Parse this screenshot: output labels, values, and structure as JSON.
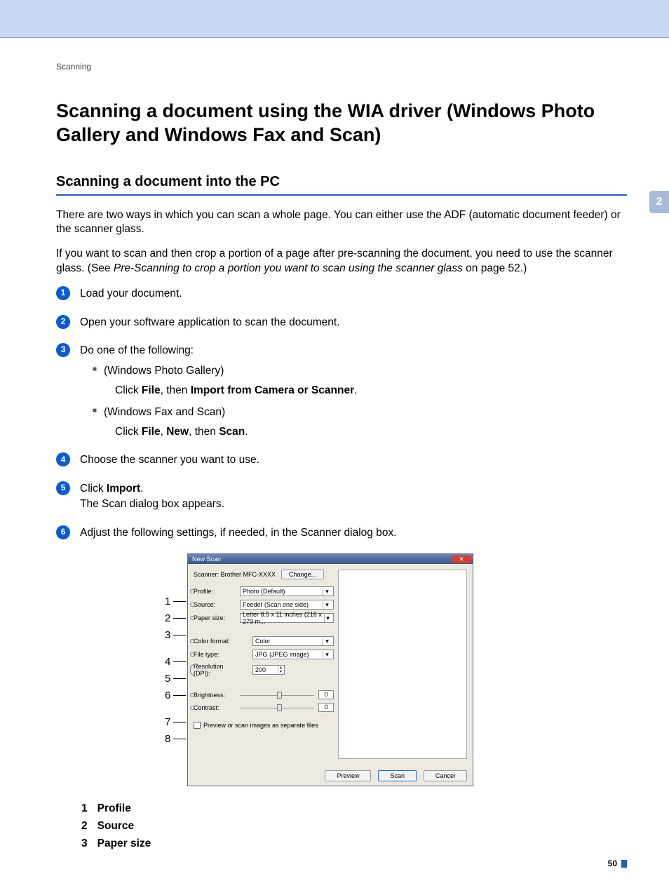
{
  "breadcrumb": "Scanning",
  "chapter_tab": "2",
  "title": "Scanning a document using the WIA driver (Windows Photo Gallery and Windows Fax and Scan)",
  "h2": "Scanning a document into the PC",
  "para1": "There are two ways in which you can scan a whole page. You can either use the ADF (automatic document feeder) or the scanner glass.",
  "para2_a": "If you want to scan and then crop a portion of a page after pre-scanning the document, you need to use the scanner glass. (See ",
  "para2_link": "Pre-Scanning to crop a portion you want to scan using the scanner glass",
  "para2_b": " on page 52.)",
  "steps": {
    "s1": "Load your document.",
    "s2": "Open your software application to scan the document.",
    "s3": "Do one of the following:",
    "s3a": "(Windows Photo Gallery)",
    "s3a_click_a": "Click ",
    "s3a_file": "File",
    "s3a_then": ", then ",
    "s3a_import": "Import from Camera or Scanner",
    "s3a_dot": ".",
    "s3b": "(Windows Fax and Scan)",
    "s3b_click_a": "Click ",
    "s3b_file": "File",
    "s3b_c1": ", ",
    "s3b_new": "New",
    "s3b_c2": ", then ",
    "s3b_scan": "Scan",
    "s3b_dot": ".",
    "s4": "Choose the scanner you want to use.",
    "s5a": "Click ",
    "s5b": "Import",
    "s5c": ".",
    "s5d": "The Scan dialog box appears.",
    "s6": "Adjust the following settings, if needed, in the Scanner dialog box."
  },
  "dialog": {
    "title": "New Scan",
    "close": "✕",
    "scanner_lbl": "Scanner: Brother MFC-XXXX",
    "change": "Change...",
    "fields": {
      "profile_l": "Profile:",
      "profile_v": "Photo (Default)",
      "source_l": "Source:",
      "source_v": "Feeder (Scan one side)",
      "paper_l": "Paper size:",
      "paper_v": "Letter 8.5 x 11 inches (216 x 279 m...",
      "color_l": "Color format:",
      "color_v": "Color",
      "file_l": "File type:",
      "file_v": "JPG (JPEG image)",
      "res_l": "Resolution (DPI):",
      "res_v": "200",
      "bright_l": "Brightness:",
      "bright_v": "0",
      "contrast_l": "Contrast:",
      "contrast_v": "0"
    },
    "checkbox": "Preview or scan images as separate files",
    "btn_preview": "Preview",
    "btn_scan": "Scan",
    "btn_cancel": "Cancel"
  },
  "callout_nums": [
    "1",
    "2",
    "3",
    "4",
    "5",
    "6",
    "7",
    "8"
  ],
  "legend": [
    {
      "n": "1",
      "t": "Profile"
    },
    {
      "n": "2",
      "t": "Source"
    },
    {
      "n": "3",
      "t": "Paper size"
    }
  ],
  "page_number": "50"
}
